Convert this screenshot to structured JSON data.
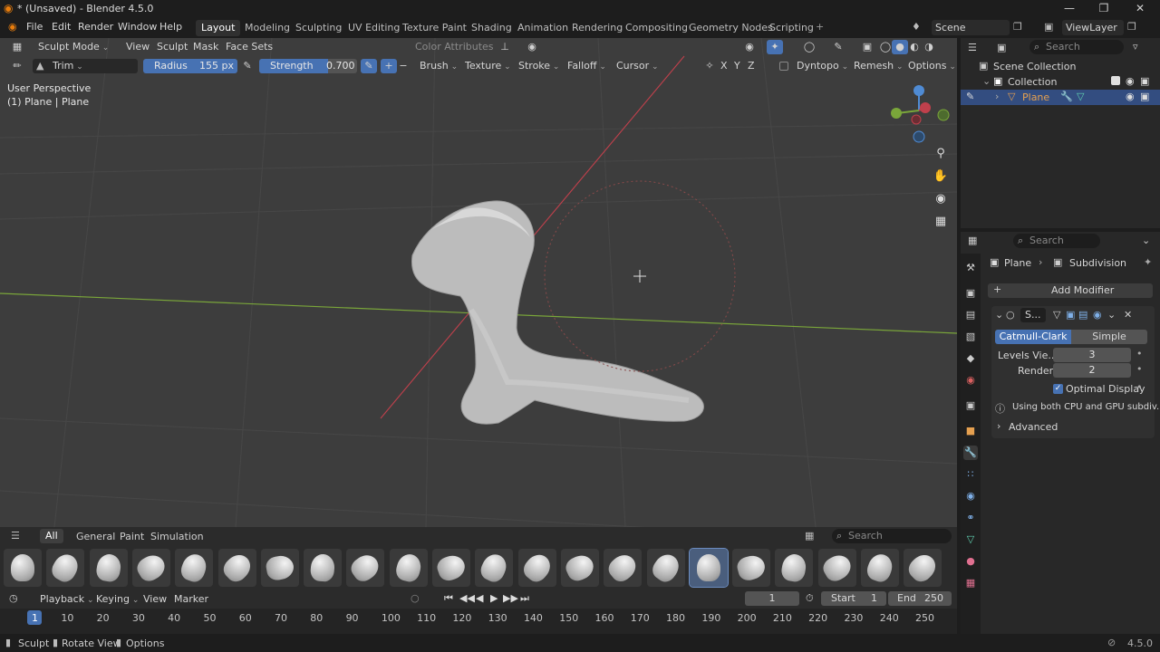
{
  "window": {
    "title": "* (Unsaved) - Blender 4.5.0"
  },
  "menubar": {
    "menus": [
      "File",
      "Edit",
      "Render",
      "Window",
      "Help"
    ],
    "workspaces": [
      "Layout",
      "Modeling",
      "Sculpting",
      "UV Editing",
      "Texture Paint",
      "Shading",
      "Animation",
      "Rendering",
      "Compositing",
      "Geometry Nodes",
      "Scripting"
    ],
    "active_workspace": "Layout",
    "scene": "Scene",
    "view_layer": "ViewLayer"
  },
  "viewport_header": {
    "mode": "Sculpt Mode",
    "menus": [
      "View",
      "Sculpt",
      "Mask",
      "Face Sets"
    ],
    "color_attributes": "Color Attributes"
  },
  "tool_settings": {
    "brush_name": "Trim",
    "radius_label": "Radius",
    "radius_value": "155 px",
    "strength_label": "Strength",
    "strength_value": "0.700",
    "strength_fraction": 0.7,
    "menus": [
      "Brush",
      "Texture",
      "Stroke",
      "Falloff",
      "Cursor"
    ],
    "axes": [
      "X",
      "Y",
      "Z"
    ],
    "dyntopo": "Dyntopo",
    "remesh": "Remesh",
    "options": "Options"
  },
  "viewport_overlay": {
    "perspective": "User Perspective",
    "object_info": "(1) Plane | Plane"
  },
  "asset_shelf": {
    "tabs": [
      "All",
      "General",
      "Paint",
      "Simulation"
    ],
    "active_tab": "All",
    "search_placeholder": "Search",
    "brush_count": 22,
    "active_brush_index": 16
  },
  "timeline": {
    "menus": [
      "Playback",
      "Keying",
      "View",
      "Marker"
    ],
    "current_frame": "1",
    "start_label": "Start",
    "start_value": "1",
    "end_label": "End",
    "end_value": "250",
    "ticks": [
      "1",
      "10",
      "20",
      "30",
      "40",
      "50",
      "60",
      "70",
      "80",
      "90",
      "100",
      "110",
      "120",
      "130",
      "140",
      "150",
      "160",
      "170",
      "180",
      "190",
      "200",
      "210",
      "220",
      "230",
      "240",
      "250"
    ]
  },
  "outliner": {
    "search_placeholder": "Search",
    "scene_collection": "Scene Collection",
    "collection": "Collection",
    "object": "Plane"
  },
  "properties": {
    "search_placeholder": "Search",
    "breadcrumb_object": "Plane",
    "breadcrumb_modifier": "Subdivision",
    "add_modifier": "Add Modifier",
    "modifier_name": "S...",
    "mode_catmull": "Catmull-Clark",
    "mode_simple": "Simple",
    "levels_viewport_label": "Levels Vie...",
    "levels_viewport_value": "3",
    "render_label": "Render",
    "render_value": "2",
    "optimal_display": "Optimal Display",
    "info_text": "Using both CPU and GPU subdiv...",
    "advanced": "Advanced"
  },
  "statusbar": {
    "items": [
      "Sculpt",
      "Rotate View",
      "Options"
    ],
    "version": "4.5.0"
  },
  "colors": {
    "accent_blue": "#4772b3",
    "viewport_bg": "#3d3d3d",
    "panel_bg": "#282828",
    "x_axis": "#c0404c",
    "y_axis": "#7aa63a",
    "object_orange": "#e5a050"
  }
}
